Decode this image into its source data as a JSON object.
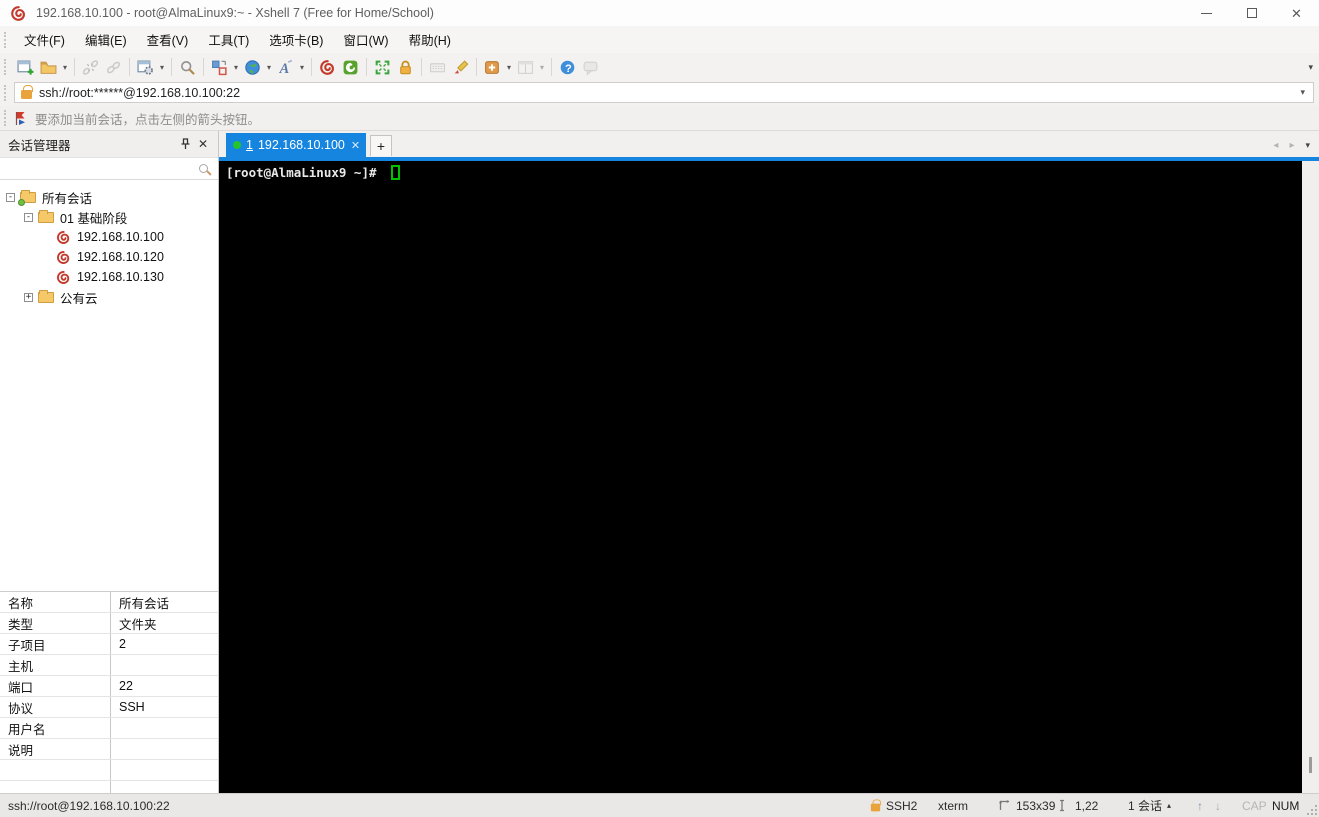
{
  "window": {
    "title": "192.168.10.100 - root@AlmaLinux9:~ - Xshell 7 (Free for Home/School)",
    "close_glyph": "✕"
  },
  "menu": {
    "items": [
      "文件(F)",
      "编辑(E)",
      "查看(V)",
      "工具(T)",
      "选项卡(B)",
      "窗口(W)",
      "帮助(H)"
    ]
  },
  "toolbar": {
    "dropdown_glyph": "▾",
    "overflow_glyph": "▾"
  },
  "address_bar": {
    "value": "ssh://root:******@192.168.10.100:22",
    "dropdown_glyph": "▾"
  },
  "info_bar": {
    "text": "要添加当前会话，点击左侧的箭头按钮。"
  },
  "session_panel": {
    "title": "会话管理器",
    "close_glyph": "✕",
    "search_placeholder": "",
    "tree": [
      {
        "expander": "-",
        "label": "所有会话"
      },
      {
        "expander": "-",
        "label": "01 基础阶段"
      },
      {
        "expander": "",
        "label": "192.168.10.100"
      },
      {
        "expander": "",
        "label": "192.168.10.120"
      },
      {
        "expander": "",
        "label": "192.168.10.130"
      },
      {
        "expander": "+",
        "label": "公有云"
      }
    ]
  },
  "tab_bar": {
    "active_tab": {
      "number": "1",
      "host": "192.168.10.100",
      "close_glyph": "✕"
    },
    "new_tab_glyph": "+",
    "nav_left_glyph": "◂",
    "nav_right_glyph": "▸",
    "nav_menu_glyph": "▾"
  },
  "terminal": {
    "prompt": "[root@AlmaLinux9 ~]# "
  },
  "properties": {
    "rows": [
      {
        "label": "名称",
        "value": "所有会话"
      },
      {
        "label": "类型",
        "value": "文件夹"
      },
      {
        "label": "子项目",
        "value": "2"
      },
      {
        "label": "主机",
        "value": ""
      },
      {
        "label": "端口",
        "value": "22"
      },
      {
        "label": "协议",
        "value": "SSH"
      },
      {
        "label": "用户名",
        "value": ""
      },
      {
        "label": "说明",
        "value": ""
      }
    ]
  },
  "status_bar": {
    "url": "ssh://root@192.168.10.100:22",
    "protocol": "SSH2",
    "terminal_type": "xterm",
    "screen_size": "153x39",
    "cursor_position": "1,22",
    "session_count": "1 会话",
    "session_dropdown_glyph": "▴",
    "scroll_up_glyph": "↑",
    "scroll_down_glyph": "↓",
    "caps_indicator": "CAP",
    "num_indicator": "NUM"
  },
  "icons": {
    "xshell-logo-icon": "red-spiral",
    "xftp-icon": "green-square-white-spiral",
    "search-icon": "magnifier",
    "address-lock-icon": "orange-padlock",
    "info-flag-icon": "red-flag-blue-arrow",
    "pin-icon": "pushpin",
    "folder-icon": "yellow-folder",
    "connected-dot-icon": "green-dot"
  }
}
